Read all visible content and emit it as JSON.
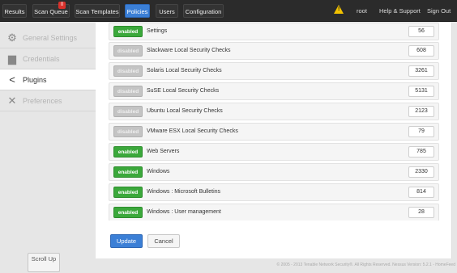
{
  "nav": {
    "results": "Results",
    "scan_queue": "Scan Queue",
    "scan_queue_badge": "0",
    "scan_templates": "Scan Templates",
    "policies": "Policies",
    "users": "Users",
    "configuration": "Configuration"
  },
  "user": {
    "warning_glyph": "!",
    "name": "root",
    "help": "Help & Support",
    "sign_out": "Sign Out"
  },
  "sidebar": {
    "items": [
      {
        "label": "General Settings",
        "icon": "gear-icon",
        "glyph": "⚙"
      },
      {
        "label": "Credentials",
        "icon": "folder-lock-icon",
        "glyph": "▆"
      },
      {
        "label": "Plugins",
        "icon": "share-icon",
        "glyph": "<"
      },
      {
        "label": "Preferences",
        "icon": "wrench-icon",
        "glyph": "✕"
      }
    ],
    "scroll_up": "Scroll Up"
  },
  "plugins": [
    {
      "status": "enabled",
      "name": "Settings",
      "count": "56"
    },
    {
      "status": "disabled",
      "name": "Slackware Local Security Checks",
      "count": "608"
    },
    {
      "status": "disabled",
      "name": "Solaris Local Security Checks",
      "count": "3261"
    },
    {
      "status": "disabled",
      "name": "SuSE Local Security Checks",
      "count": "5131"
    },
    {
      "status": "disabled",
      "name": "Ubuntu Local Security Checks",
      "count": "2123"
    },
    {
      "status": "disabled",
      "name": "VMware ESX Local Security Checks",
      "count": "79"
    },
    {
      "status": "enabled",
      "name": "Web Servers",
      "count": "785"
    },
    {
      "status": "enabled",
      "name": "Windows",
      "count": "2330"
    },
    {
      "status": "enabled",
      "name": "Windows : Microsoft Bulletins",
      "count": "814"
    },
    {
      "status": "enabled",
      "name": "Windows : User management",
      "count": "28"
    }
  ],
  "actions": {
    "update": "Update",
    "cancel": "Cancel"
  },
  "footer": "© 2005 - 2013 Tenable Network Security®. All Rights Reserved. Nessus Version: 5.2.1 - HomeFeed",
  "colors": {
    "accent": "#3b7fd6",
    "enabled": "#3ba83b",
    "disabled": "#c4c4c4",
    "topbar": "#2b2b2b"
  }
}
